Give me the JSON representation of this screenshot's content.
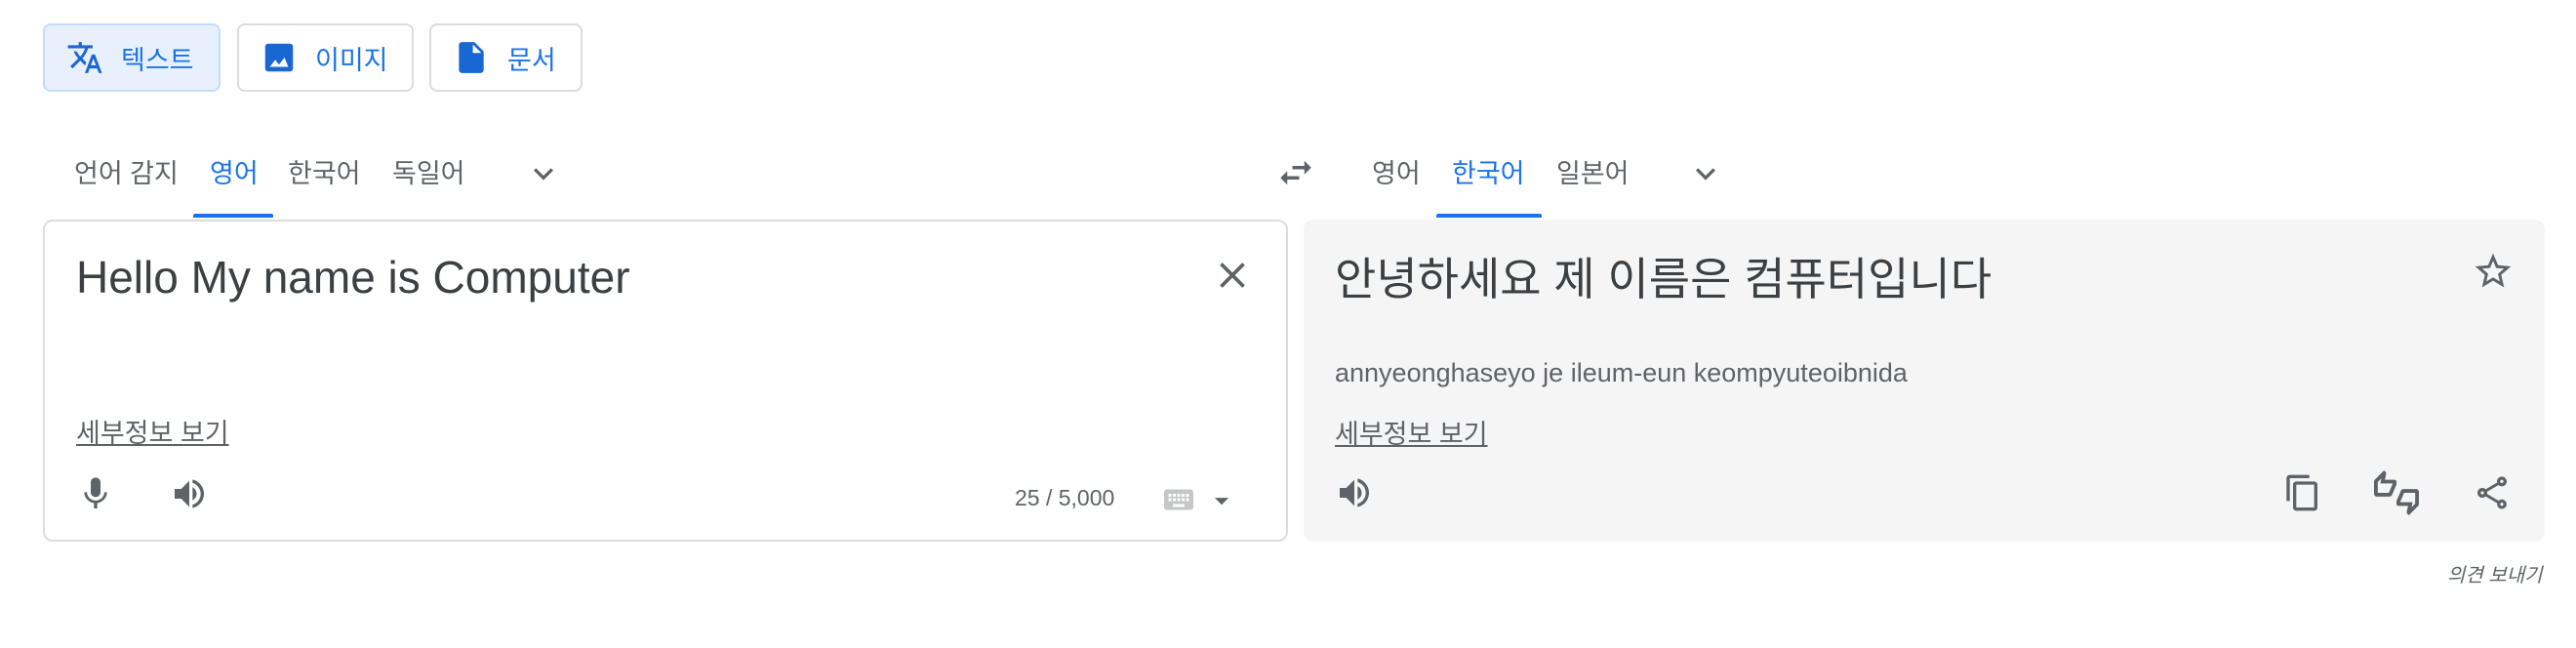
{
  "modes": [
    {
      "label": "텍스트",
      "icon": "translate-icon",
      "active": true
    },
    {
      "label": "이미지",
      "icon": "image-icon",
      "active": false
    },
    {
      "label": "문서",
      "icon": "document-icon",
      "active": false
    }
  ],
  "source_langs": [
    "언어 감지",
    "영어",
    "한국어",
    "독일어"
  ],
  "source_selected": "영어",
  "target_langs": [
    "영어",
    "한국어",
    "일본어"
  ],
  "target_selected": "한국어",
  "source": {
    "text": "Hello My name is Computer",
    "details_link": "세부정보 보기",
    "char_count": "25 / 5,000"
  },
  "target": {
    "text": "안녕하세요 제 이름은 컴퓨터입니다",
    "romanization": "annyeonghaseyo je ileum-eun keompyuteoibnida",
    "details_link": "세부정보 보기"
  },
  "feedback_label": "의견 보내기",
  "colors": {
    "accent": "#1a73e8",
    "panel_bg": "#f5f5f5",
    "border": "#dadce0"
  }
}
